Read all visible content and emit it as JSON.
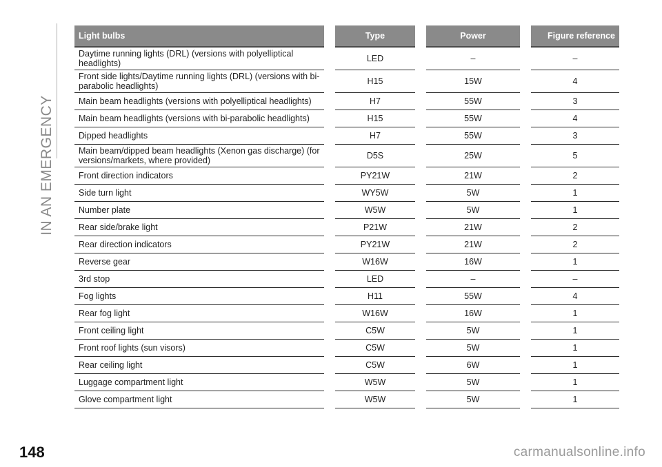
{
  "section_title": "IN AN EMERGENCY",
  "page_number": "148",
  "watermark": "carmanualsonline.info",
  "table": {
    "headers": [
      "Light bulbs",
      "Type",
      "Power",
      "Figure reference"
    ],
    "rows": [
      [
        "Daytime running lights (DRL) (versions with polyelliptical headlights)",
        "LED",
        "–",
        "–"
      ],
      [
        "Front side lights/Daytime running lights (DRL) (versions with bi-parabolic headlights)",
        "H15",
        "15W",
        "4"
      ],
      [
        "Main beam headlights (versions with polyelliptical headlights)",
        "H7",
        "55W",
        "3"
      ],
      [
        "Main beam headlights (versions with bi-parabolic headlights)",
        "H15",
        "55W",
        "4"
      ],
      [
        "Dipped headlights",
        "H7",
        "55W",
        "3"
      ],
      [
        "Main beam/dipped beam headlights (Xenon gas discharge) (for versions/markets, where provided)",
        "D5S",
        "25W",
        "5"
      ],
      [
        "Front direction indicators",
        "PY21W",
        "21W",
        "2"
      ],
      [
        "Side turn light",
        "WY5W",
        "5W",
        "1"
      ],
      [
        "Number plate",
        "W5W",
        "5W",
        "1"
      ],
      [
        "Rear side/brake light",
        "P21W",
        "21W",
        "2"
      ],
      [
        "Rear direction indicators",
        "PY21W",
        "21W",
        "2"
      ],
      [
        "Reverse gear",
        "W16W",
        "16W",
        "1"
      ],
      [
        "3rd stop",
        "LED",
        "–",
        "–"
      ],
      [
        "Fog lights",
        "H11",
        "55W",
        "4"
      ],
      [
        "Rear fog light",
        "W16W",
        "16W",
        "1"
      ],
      [
        "Front ceiling light",
        "C5W",
        "5W",
        "1"
      ],
      [
        "Front roof lights (sun visors)",
        "C5W",
        "5W",
        "1"
      ],
      [
        "Rear ceiling light",
        "C5W",
        "6W",
        "1"
      ],
      [
        "Luggage compartment light",
        "W5W",
        "5W",
        "1"
      ],
      [
        "Glove compartment light",
        "W5W",
        "5W",
        "1"
      ]
    ]
  }
}
